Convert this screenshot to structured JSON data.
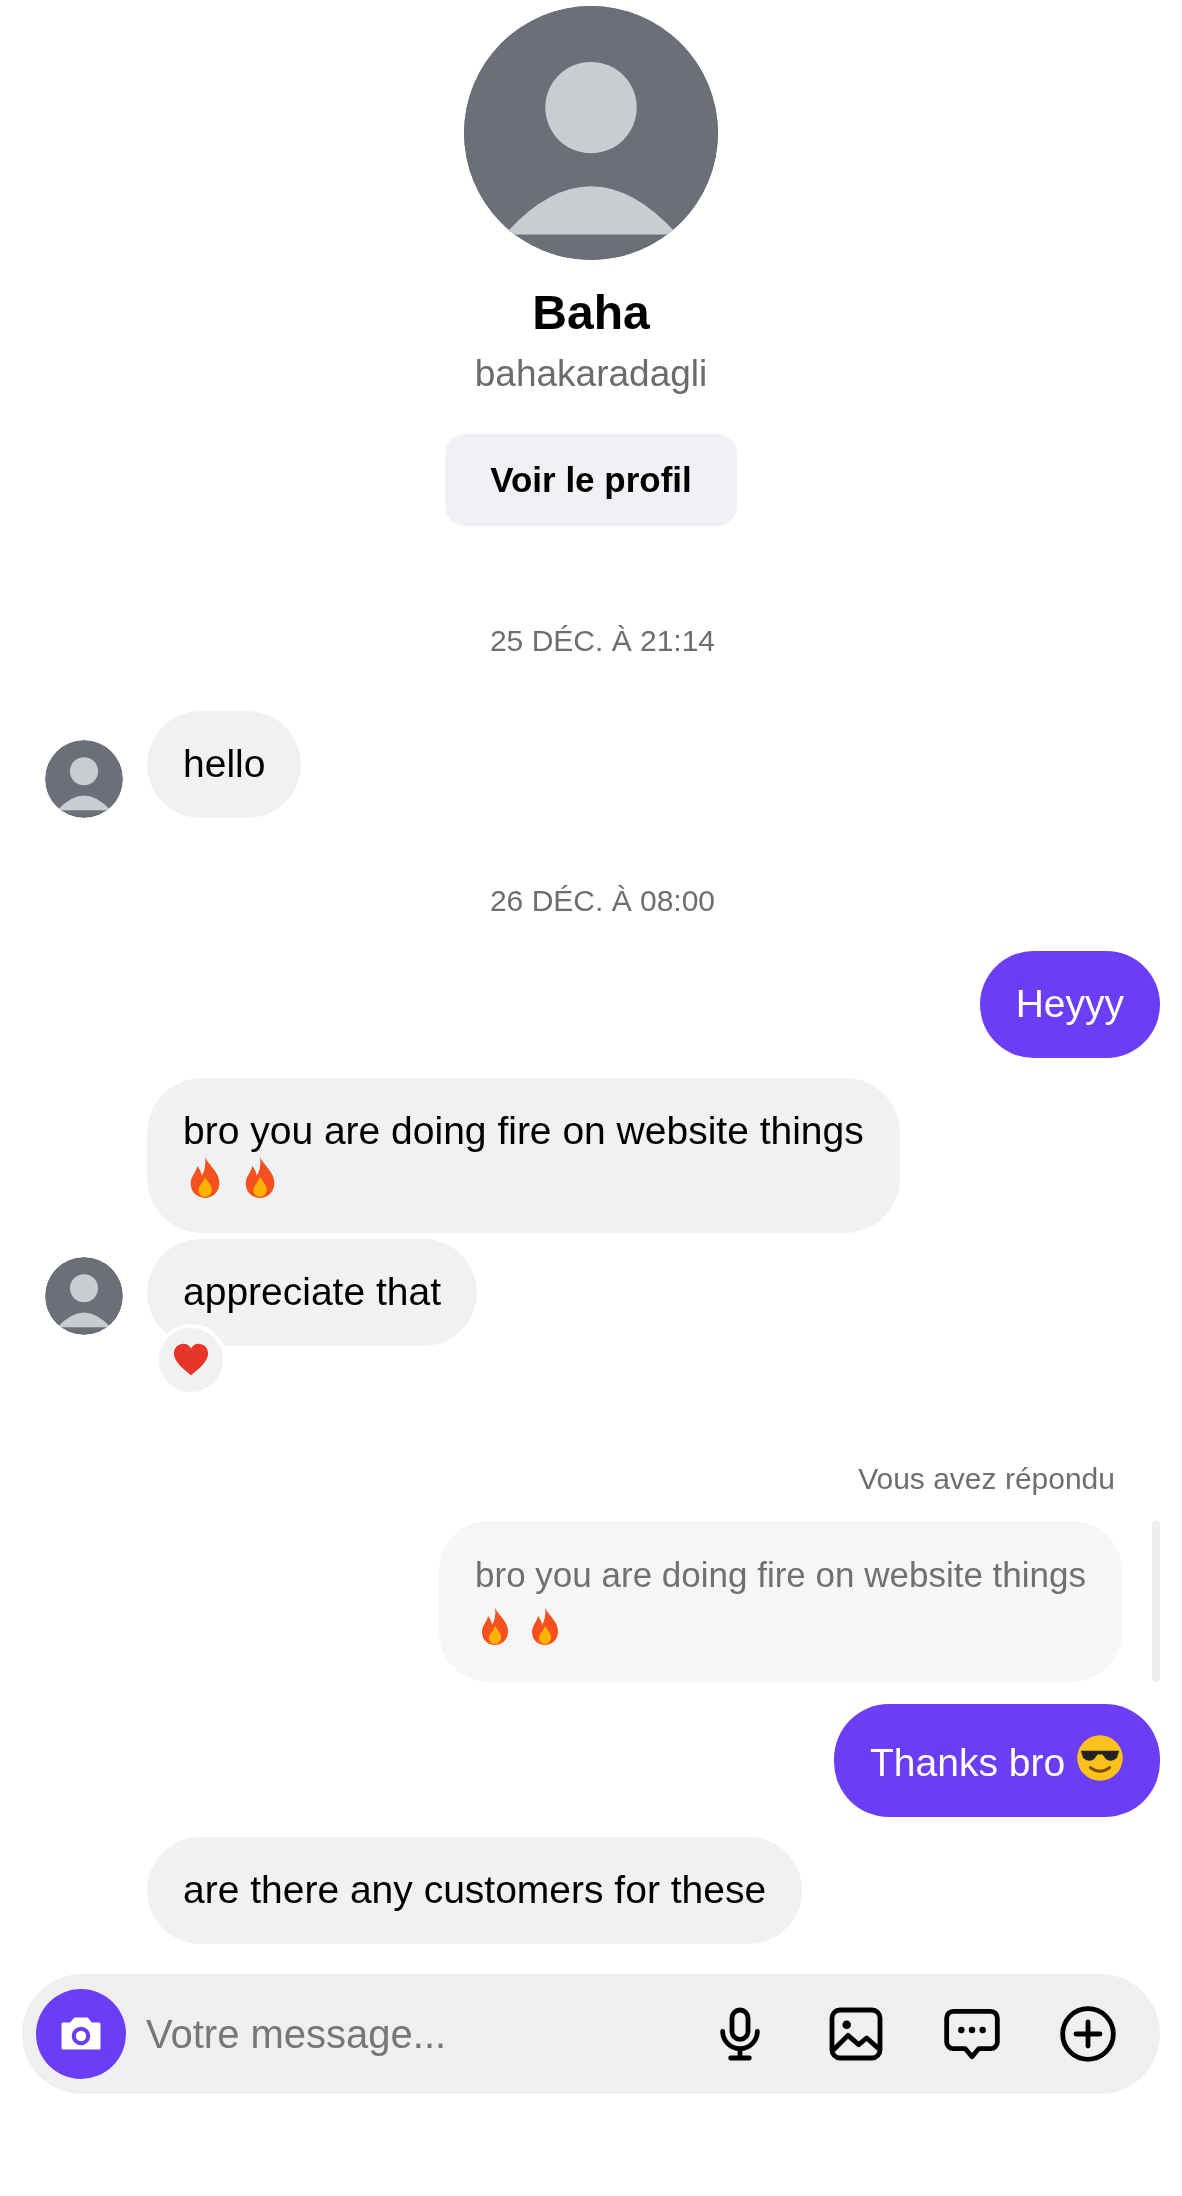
{
  "profile": {
    "name": "Baha",
    "username": "bahakaradagli",
    "button": "Voir le profil"
  },
  "messages": [
    {
      "kind": "date",
      "text": "25 DÉC. À 21:14"
    },
    {
      "kind": "received",
      "text": "hello",
      "avatar": true
    },
    {
      "kind": "date",
      "text": "26 DÉC. À 08:00"
    },
    {
      "kind": "sent",
      "text": "Heyyy"
    },
    {
      "kind": "received",
      "text": "bro you are doing fire on website things",
      "emojis": [
        {
          "kind": "fire"
        },
        {
          "kind": "fire"
        }
      ],
      "avatar": false
    },
    {
      "kind": "received",
      "text": "appreciate that",
      "avatar": true,
      "reaction": {
        "kind": "heart"
      }
    },
    {
      "kind": "reply_label",
      "text": "Vous avez répondu"
    },
    {
      "kind": "quoted",
      "text": "bro you are doing fire on website things",
      "emojis": [
        {
          "kind": "fire"
        },
        {
          "kind": "fire"
        }
      ]
    },
    {
      "kind": "sent",
      "text": "Thanks bro",
      "emojis": [
        {
          "kind": "sunglasses"
        }
      ]
    },
    {
      "kind": "received",
      "text": "are there any customers for these",
      "avatar": false
    }
  ],
  "composer": {
    "placeholder": "Votre message..."
  }
}
